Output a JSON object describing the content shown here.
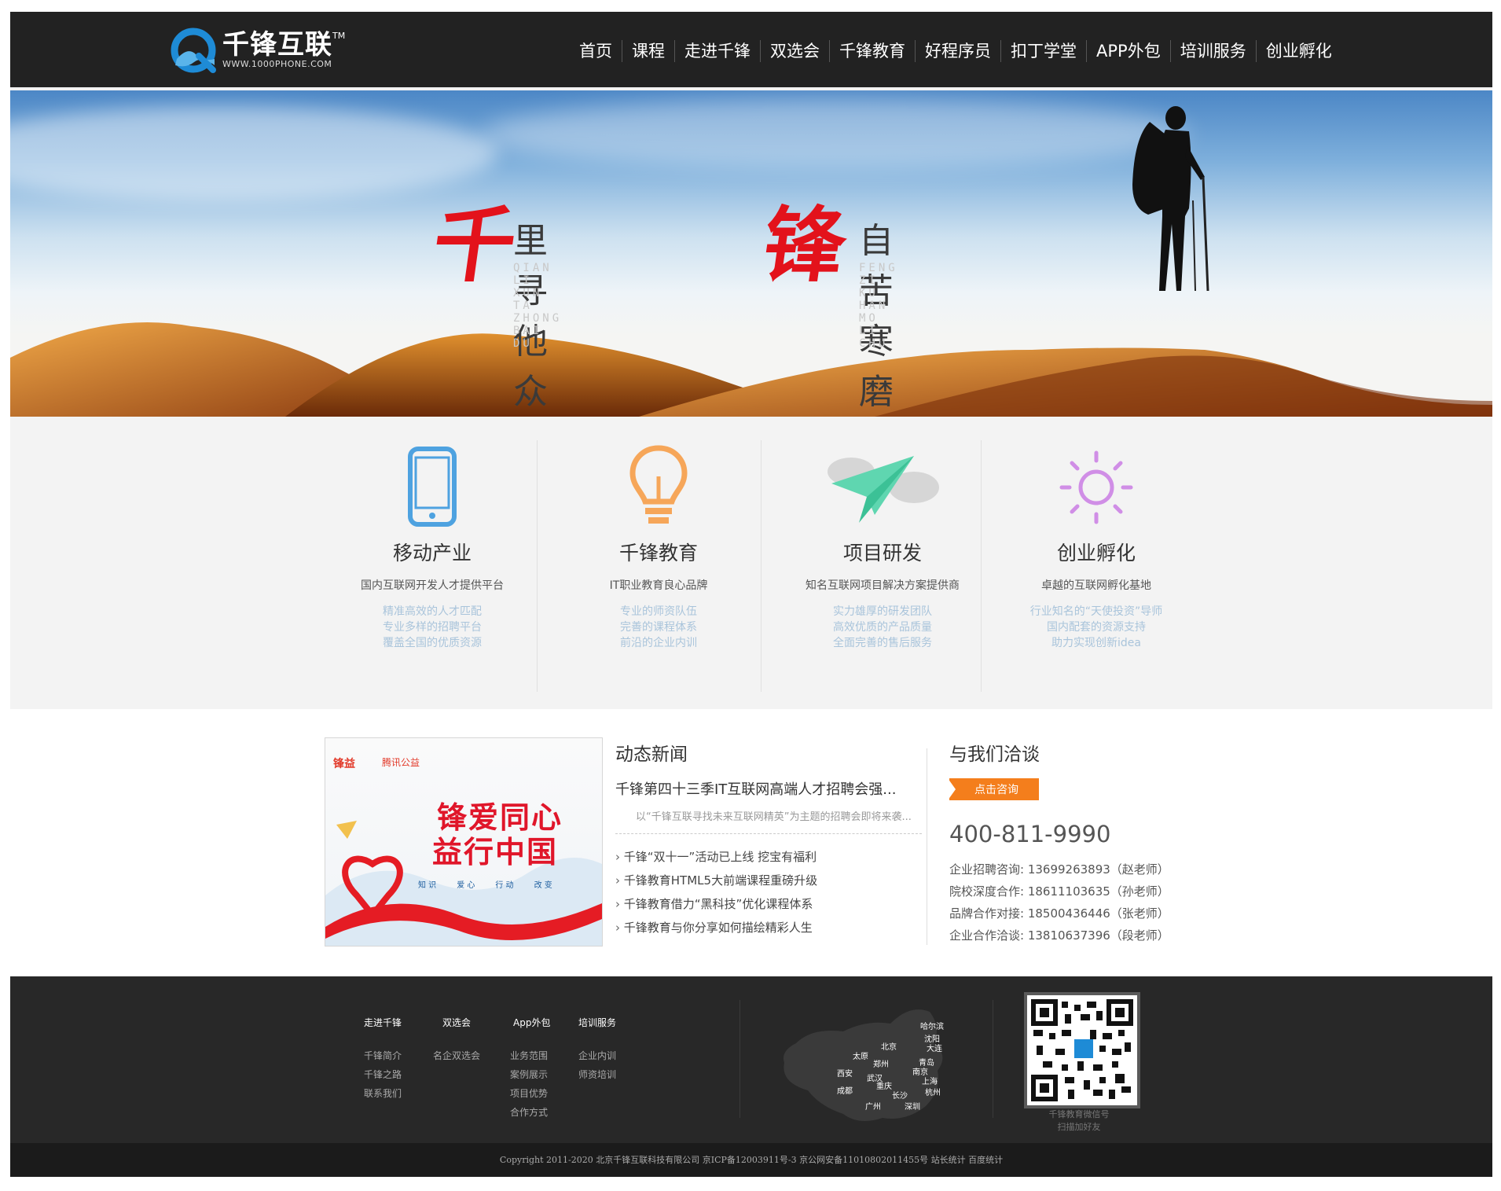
{
  "header": {
    "logo_name": "千锋互联",
    "logo_tm": "TM",
    "logo_url": "WWW.1000PHONE.COM",
    "nav": [
      "首页",
      "课程",
      "走进千锋",
      "双选会",
      "千锋教育",
      "好程序员",
      "扣丁学堂",
      "APP外包",
      "培训服务",
      "创业孵化"
    ]
  },
  "banner": {
    "char1": "千",
    "phrase1": "里寻他众百度",
    "pinyin1": "QIAN LI XUN TA ZHONG BAI DU",
    "char2": "锋",
    "phrase2": "自苦寒磨砺出",
    "pinyin2": "FENG ZI KU HAN MO LI CHU"
  },
  "features": [
    {
      "icon": "phone-icon",
      "title": "移动产业",
      "subtitle": "国内互联网开发人才提供平台",
      "desc": [
        "精准高效的人才匹配",
        "专业多样的招聘平台",
        "覆盖全国的优质资源"
      ]
    },
    {
      "icon": "lightbulb-icon",
      "title": "千锋教育",
      "subtitle": "IT职业教育良心品牌",
      "desc": [
        "专业的师资队伍",
        "完善的课程体系",
        "前沿的企业内训"
      ]
    },
    {
      "icon": "paper-plane-icon",
      "title": "项目研发",
      "subtitle": "知名互联网项目解决方案提供商",
      "desc": [
        "实力雄厚的研发团队",
        "高效优质的产品质量",
        "全面完善的售后服务"
      ]
    },
    {
      "icon": "sun-icon",
      "title": "创业孵化",
      "subtitle": "卓越的互联网孵化基地",
      "desc": [
        "行业知名的“天使投资”导师",
        "国内配套的资源支持",
        "助力实现创新idea"
      ]
    }
  ],
  "promo": {
    "brand1": "锋益",
    "brand2": "腾讯公益",
    "line1": "锋爱同心",
    "line2": "益行中国",
    "tags": [
      "知 识",
      "爱 心",
      "行 动",
      "改 变"
    ]
  },
  "news": {
    "title": "动态新闻",
    "headline": "千锋第四十三季IT互联网高端人才招聘会强...",
    "summary": "以“千锋互联寻找未来互联网精英”为主题的招聘会即将来袭...",
    "items": [
      "千锋“双十一”活动已上线 挖宝有福利",
      "千锋教育HTML5大前端课程重磅升级",
      "千锋教育借力“黑科技”优化课程体系",
      "千锋教育与你分享如何描绘精彩人生"
    ]
  },
  "contact": {
    "title": "与我们洽谈",
    "button": "点击咨询",
    "phone": "400-811-9990",
    "rows": [
      "企业招聘咨询: 13699263893（赵老师）",
      "院校深度合作: 18611103635（孙老师）",
      "品牌合作对接: 18500436446（张老师）",
      "企业合作洽谈: 13810637396（段老师）"
    ]
  },
  "footer": {
    "columns": [
      {
        "title": "走进千锋",
        "links": [
          "千锋简介",
          "千锋之路",
          "联系我们"
        ]
      },
      {
        "title": "双选会",
        "links": [
          "名企双选会"
        ]
      },
      {
        "title": "App外包",
        "links": [
          "业务范围",
          "案例展示",
          "项目优势",
          "合作方式"
        ]
      },
      {
        "title": "培训服务",
        "links": [
          "企业内训",
          "师资培训"
        ]
      }
    ],
    "cities": [
      "哈尔滨",
      "沈阳",
      "大连",
      "北京",
      "太原",
      "郑州",
      "青岛",
      "西安",
      "武汉",
      "南京",
      "上海",
      "成都",
      "重庆",
      "长沙",
      "杭州",
      "广州",
      "深圳"
    ],
    "qr_caption1": "千锋教育微信号",
    "qr_caption2": "扫描加好友",
    "copyright": "Copyright 2011-2020 北京千锋互联科技有限公司 京ICP备12003911号-3 京公网安备11010802011455号 站长统计 百度统计"
  },
  "colors": {
    "header_bg": "#222222",
    "accent_red": "#e3121b",
    "accent_orange": "#f47e1c",
    "footer_bg": "#282828"
  }
}
